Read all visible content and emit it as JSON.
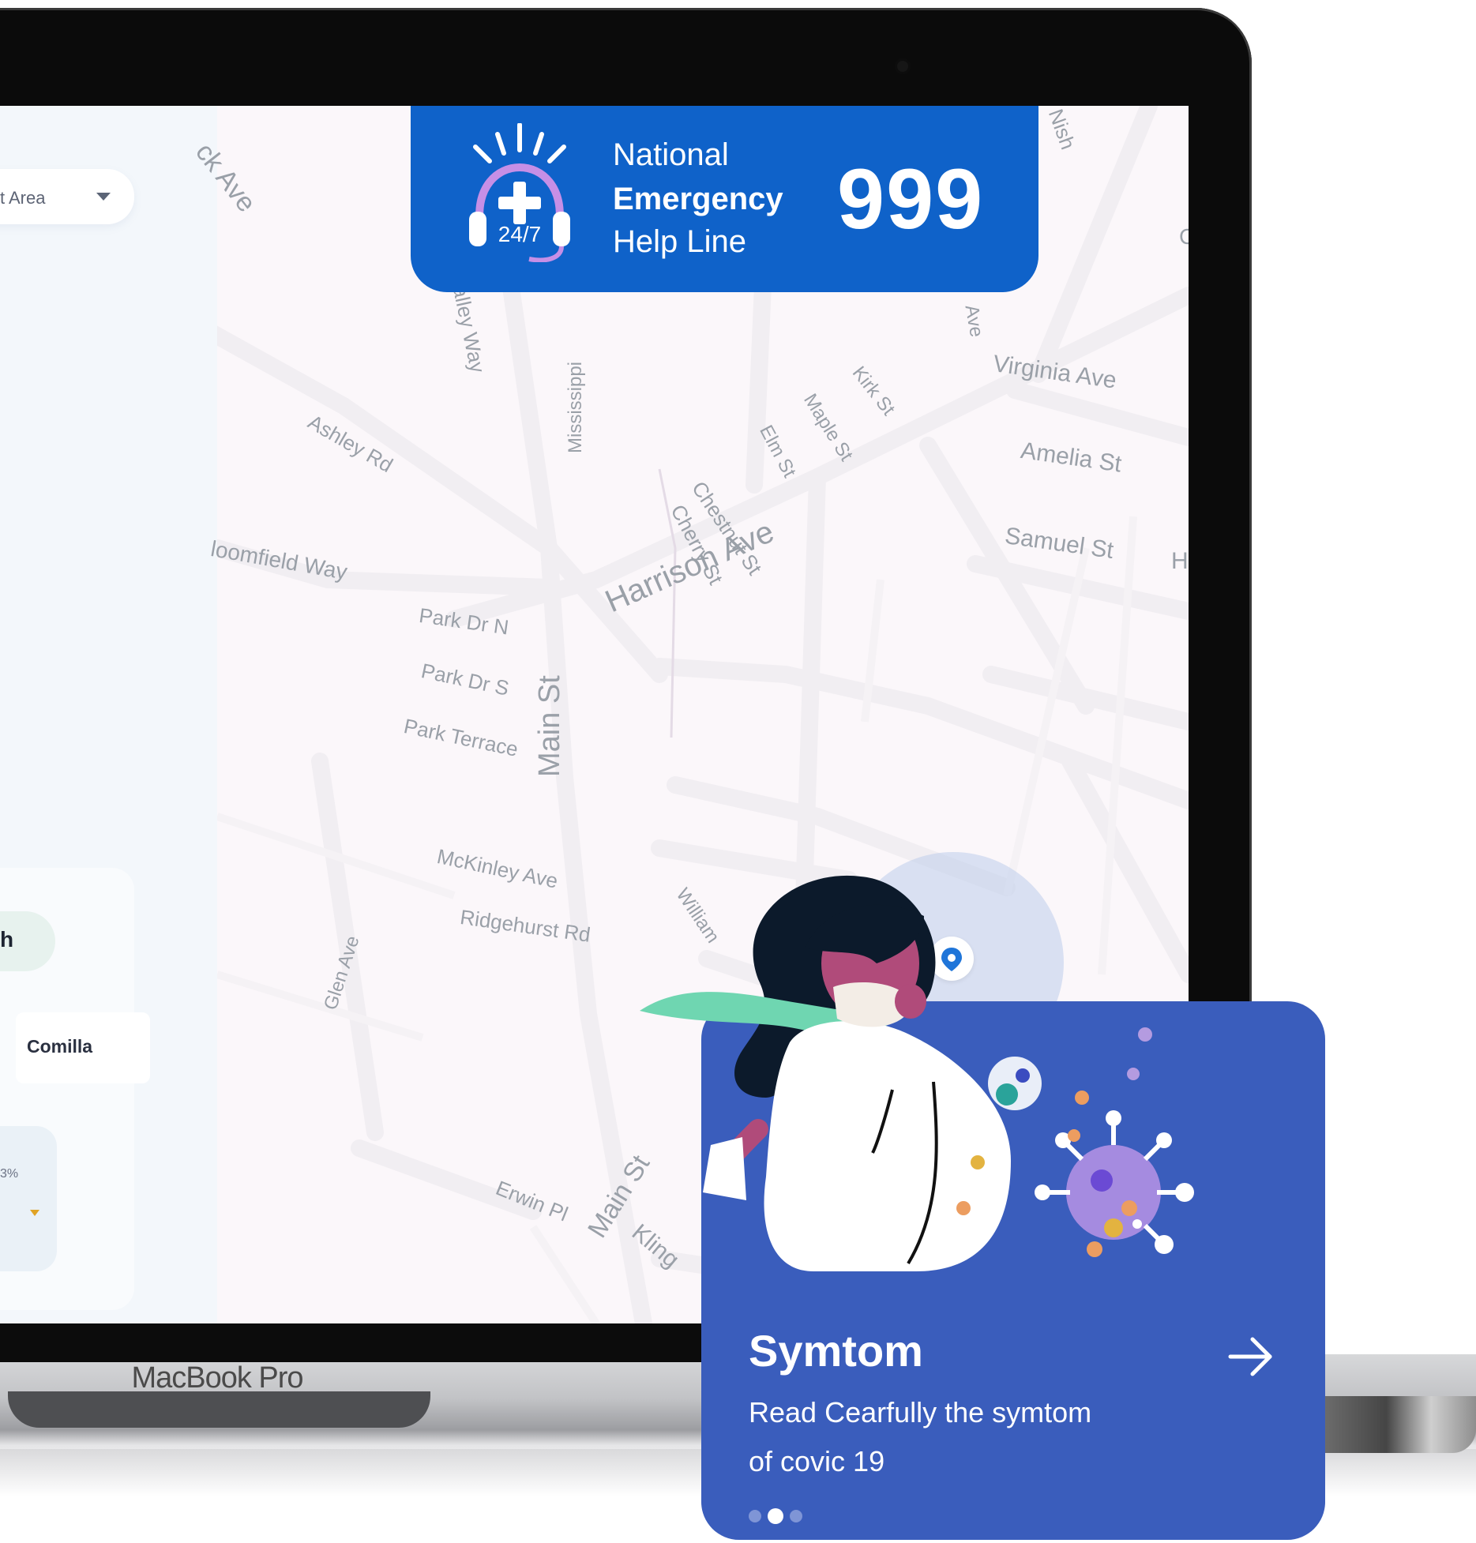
{
  "device": {
    "model_label": "MacBook Pro"
  },
  "left_panel": {
    "area_select": {
      "value": "t Area"
    },
    "search_button_label": "h",
    "city_tab_label": "Comilla",
    "stat": {
      "percent_text": "3%"
    }
  },
  "map": {
    "roads": [
      "ck Ave",
      "alley Way",
      "Mississippi",
      "Nish",
      "Ave",
      "Virginia Ave",
      "Kirk St",
      "Ashley Rd",
      "Harrison Ave",
      "Elm St",
      "Maple St",
      "Amelia St",
      "Chestnut St",
      "Cherry St",
      "Samuel St",
      "H",
      "loomfield Way",
      "Main St",
      "Park Dr N",
      "Park Dr S",
      "Park Terrace",
      "McKinley Ave",
      "William",
      "Ridgehurst Rd",
      "Glen Ave",
      "Erwin Pl",
      "Main St",
      "Kling",
      "C"
    ]
  },
  "helpline": {
    "line1": "National",
    "line2": "Emergency",
    "line3": "Help Line",
    "number": "999",
    "icon_text": "24/7",
    "icon": "headset-plus-icon"
  },
  "symptom_card": {
    "title": "Symtom",
    "description_line1": "Read Cearfully the symtom",
    "description_line2": "of covic 19",
    "arrow_icon": "arrow-right-icon",
    "pagination": {
      "count": 3,
      "active_index": 1
    }
  },
  "colors": {
    "helpline_bg": "#0f62c9",
    "card_bg": "#3a5dbc",
    "map_bg": "#fbf7fa",
    "pin": "#1f75d9"
  }
}
